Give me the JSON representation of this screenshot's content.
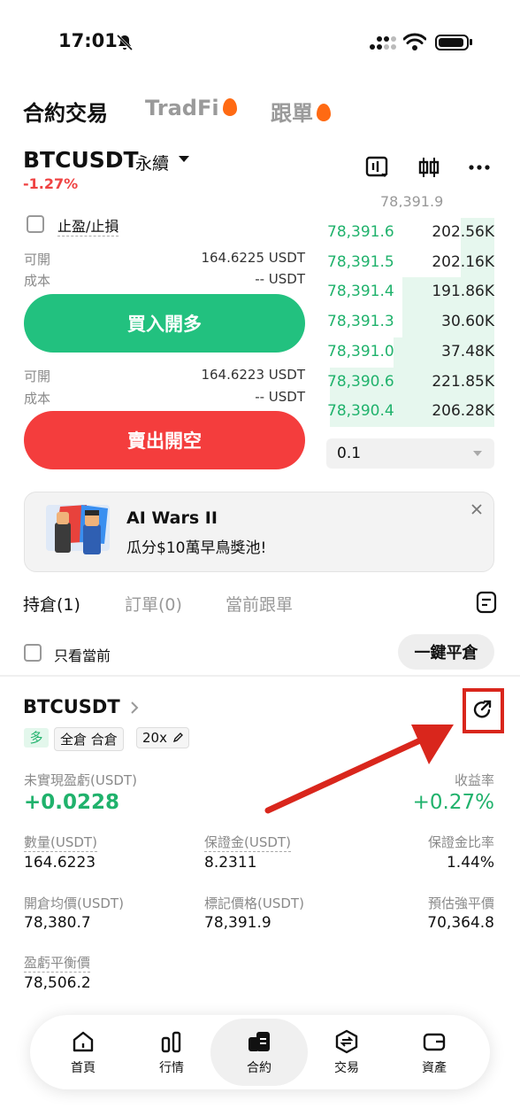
{
  "status_bar": {
    "time": "17:01"
  },
  "top_tabs": [
    {
      "label": "合約交易",
      "active": true
    },
    {
      "label": "TradFi",
      "active": false,
      "hot": true
    },
    {
      "label": "跟單",
      "active": false,
      "hot": true
    }
  ],
  "market": {
    "symbol": "BTCUSDT",
    "type": "永續",
    "change": "-1.27%"
  },
  "tp_sl_label": "止盈/止損",
  "buy": {
    "avail_label": "可開",
    "avail_value": "164.6225 USDT",
    "cost_label": "成本",
    "cost_value": "-- USDT",
    "button": "買入開多"
  },
  "sell": {
    "avail_label": "可開",
    "avail_value": "164.6223 USDT",
    "cost_label": "成本",
    "cost_value": "-- USDT",
    "button": "賣出開空"
  },
  "orderbook": {
    "partial_top": "78,391.9",
    "rows": [
      {
        "price": "78,391.6",
        "qty": "202.56K",
        "depth": 0.2
      },
      {
        "price": "78,391.5",
        "qty": "202.16K",
        "depth": 0.2
      },
      {
        "price": "78,391.4",
        "qty": "191.86K",
        "depth": 0.55
      },
      {
        "price": "78,391.3",
        "qty": "30.60K",
        "depth": 0.55
      },
      {
        "price": "78,391.0",
        "qty": "37.48K",
        "depth": 0.6
      },
      {
        "price": "78,390.6",
        "qty": "221.85K",
        "depth": 0.98
      },
      {
        "price": "78,390.4",
        "qty": "206.28K",
        "depth": 0.98
      }
    ],
    "precision": "0.1"
  },
  "banner": {
    "title": "AI Wars II",
    "subtitle": "瓜分$10萬早鳥獎池!"
  },
  "section_tabs": [
    "持倉(1)",
    "訂單(0)",
    "當前跟單"
  ],
  "only_current_label": "只看當前",
  "close_all_label": "一鍵平倉",
  "position": {
    "symbol": "BTCUSDT",
    "side": "多",
    "margin_mode": "全倉 合倉",
    "leverage": "20x",
    "pnl_label": "未實現盈虧(USDT)",
    "pnl_value": "+0.0228",
    "roe_label": "收益率",
    "roe_value": "+0.27%",
    "qty_label": "數量(USDT)",
    "qty_value": "164.6223",
    "margin_label": "保證金(USDT)",
    "margin_value": "8.2311",
    "margin_ratio_label": "保證金比率",
    "margin_ratio_value": "1.44%",
    "entry_label": "開倉均價(USDT)",
    "entry_value": "78,380.7",
    "mark_label": "標記價格(USDT)",
    "mark_value": "78,391.9",
    "liq_label": "預估強平價",
    "liq_value": "70,364.8",
    "breakeven_label": "盈虧平衡價",
    "breakeven_value": "78,506.2"
  },
  "nav": [
    {
      "label": "首頁",
      "icon": "home-icon"
    },
    {
      "label": "行情",
      "icon": "chart-icon"
    },
    {
      "label": "合約",
      "icon": "contract-icon",
      "active": true
    },
    {
      "label": "交易",
      "icon": "trade-icon"
    },
    {
      "label": "資產",
      "icon": "wallet-icon"
    }
  ],
  "colors": {
    "green": "#20b26c",
    "red": "#ef4343",
    "annotation": "#d9261c"
  }
}
